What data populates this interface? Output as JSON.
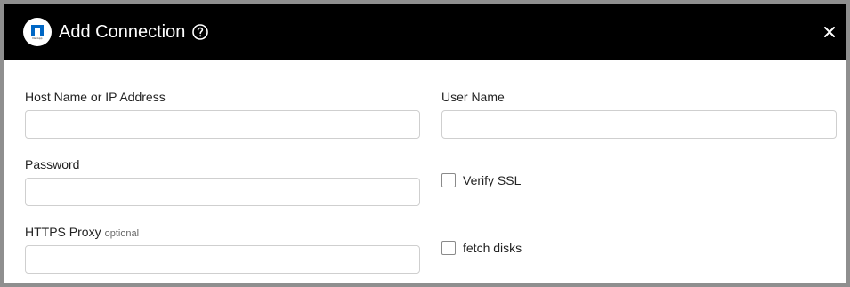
{
  "dialog": {
    "title": "Add Connection",
    "logo_text": "NetApp",
    "help_icon": "help-circle-icon",
    "close_icon": "close-icon"
  },
  "form": {
    "host": {
      "label": "Host Name or IP Address",
      "value": ""
    },
    "user": {
      "label": "User Name",
      "value": ""
    },
    "password": {
      "label": "Password",
      "value": ""
    },
    "proxy": {
      "label": "HTTPS Proxy",
      "optional": "optional",
      "value": ""
    },
    "verify_ssl": {
      "label": "Verify SSL",
      "checked": false
    },
    "fetch_disks": {
      "label": "fetch disks",
      "checked": false
    }
  },
  "colors": {
    "header_bg": "#000000",
    "frame": "#8f8f8f",
    "logo_blue": "#0067c5"
  }
}
